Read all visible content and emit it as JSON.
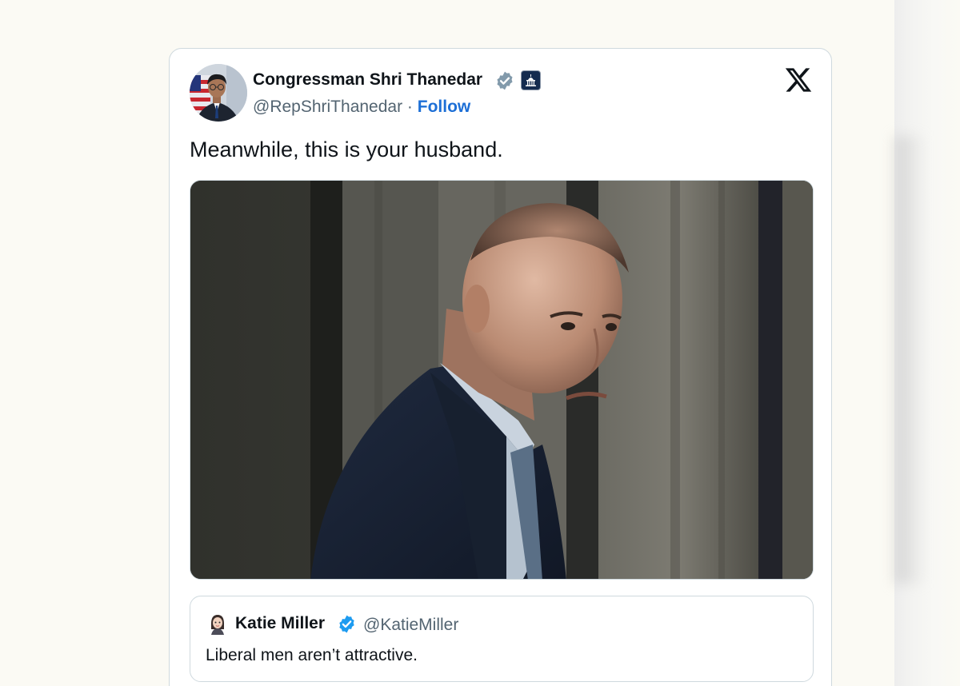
{
  "tweet": {
    "author": {
      "name": "Congressman Shri Thanedar",
      "handle": "@RepShriThanedar",
      "separator": " · ",
      "follow_label": "Follow"
    },
    "text": "Meanwhile, this is your husband.",
    "platform_icon": "x-logo-icon",
    "media": {
      "icon": "photo-media"
    },
    "quoted_tweet": {
      "name": "Katie Miller",
      "handle": "@KatieMiller",
      "text": "Liberal men aren’t attractive."
    }
  },
  "colors": {
    "background": "#fbfaf4",
    "card_border": "#cfd9de",
    "link_blue": "#1d6fd6",
    "verified_gray": "#829aab",
    "verified_blue": "#1d9bf0",
    "text_primary": "#0f1419",
    "text_secondary": "#536471"
  }
}
